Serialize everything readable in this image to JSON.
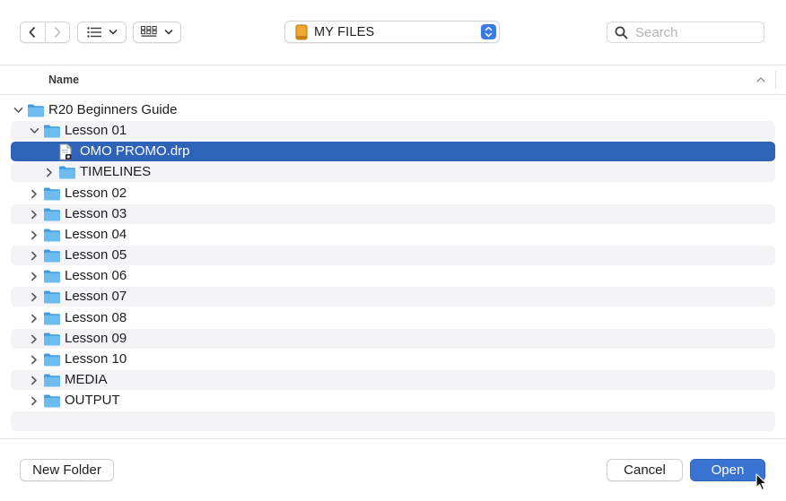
{
  "toolbar": {
    "back_icon": "chevron-left-icon",
    "forward_icon": "chevron-right-icon",
    "view_icon": "list-view-icon",
    "group_icon": "grid-group-icon",
    "location": {
      "label": "MY FILES",
      "icon": "drive-icon"
    },
    "search": {
      "placeholder": "Search",
      "value": "",
      "icon": "search-icon"
    }
  },
  "columns": {
    "name": "Name",
    "sort": "ascending"
  },
  "files": [
    {
      "label": "R20 Beginners Guide",
      "type": "folder",
      "depth": 0,
      "expanded": true,
      "has_children": true,
      "selected": false,
      "alt": false
    },
    {
      "label": "Lesson 01",
      "type": "folder",
      "depth": 1,
      "expanded": true,
      "has_children": true,
      "selected": false,
      "alt": true
    },
    {
      "label": "OMO PROMO.drp",
      "type": "file",
      "depth": 2,
      "expanded": false,
      "has_children": false,
      "selected": true,
      "alt": false
    },
    {
      "label": "TIMELINES",
      "type": "folder",
      "depth": 2,
      "expanded": false,
      "has_children": true,
      "selected": false,
      "alt": true
    },
    {
      "label": "Lesson 02",
      "type": "folder",
      "depth": 1,
      "expanded": false,
      "has_children": true,
      "selected": false,
      "alt": false
    },
    {
      "label": "Lesson 03",
      "type": "folder",
      "depth": 1,
      "expanded": false,
      "has_children": true,
      "selected": false,
      "alt": true
    },
    {
      "label": "Lesson 04",
      "type": "folder",
      "depth": 1,
      "expanded": false,
      "has_children": true,
      "selected": false,
      "alt": false
    },
    {
      "label": "Lesson 05",
      "type": "folder",
      "depth": 1,
      "expanded": false,
      "has_children": true,
      "selected": false,
      "alt": true
    },
    {
      "label": "Lesson 06",
      "type": "folder",
      "depth": 1,
      "expanded": false,
      "has_children": true,
      "selected": false,
      "alt": false
    },
    {
      "label": "Lesson 07",
      "type": "folder",
      "depth": 1,
      "expanded": false,
      "has_children": true,
      "selected": false,
      "alt": true
    },
    {
      "label": "Lesson 08",
      "type": "folder",
      "depth": 1,
      "expanded": false,
      "has_children": true,
      "selected": false,
      "alt": false
    },
    {
      "label": "Lesson 09",
      "type": "folder",
      "depth": 1,
      "expanded": false,
      "has_children": true,
      "selected": false,
      "alt": true
    },
    {
      "label": "Lesson 10",
      "type": "folder",
      "depth": 1,
      "expanded": false,
      "has_children": true,
      "selected": false,
      "alt": false
    },
    {
      "label": "MEDIA",
      "type": "folder",
      "depth": 1,
      "expanded": false,
      "has_children": true,
      "selected": false,
      "alt": true
    },
    {
      "label": "OUTPUT",
      "type": "folder",
      "depth": 1,
      "expanded": false,
      "has_children": true,
      "selected": false,
      "alt": false
    },
    {
      "label": "",
      "type": "empty",
      "depth": 0,
      "expanded": false,
      "has_children": false,
      "selected": false,
      "alt": true
    }
  ],
  "footer": {
    "new_folder_label": "New Folder",
    "cancel_label": "Cancel",
    "open_label": "Open"
  },
  "colors": {
    "selection": "#2f63b8",
    "primary_button": "#3a74d3",
    "folder": "#5fb2ea",
    "stripe": "#f4f4f6"
  }
}
